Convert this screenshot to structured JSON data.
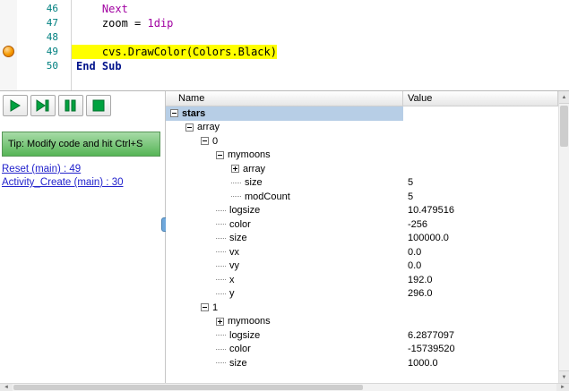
{
  "colors": {
    "execution_highlight": "#ffff00",
    "breakpoint_orange": "#e87c00",
    "line_number_teal": "#008080",
    "keyword_purple": "#a100a1",
    "keyword_navy": "#00128b",
    "debug_icon_green": "#00a23f",
    "tip_banner_green": "#56b556",
    "selection_blue": "#b7cee6",
    "link_blue": "#2222cc"
  },
  "editor": {
    "lines": [
      {
        "num": "46",
        "breakpoint": false,
        "highlight": false,
        "tokens": [
          {
            "t": "    ",
            "c": "plain"
          },
          {
            "t": "Next",
            "c": "purple"
          }
        ]
      },
      {
        "num": "47",
        "breakpoint": false,
        "highlight": false,
        "tokens": [
          {
            "t": "    ",
            "c": "plain"
          },
          {
            "t": "zoom",
            "c": "plain"
          },
          {
            "t": " = ",
            "c": "plain"
          },
          {
            "t": "1dip",
            "c": "purple"
          }
        ]
      },
      {
        "num": "48",
        "breakpoint": false,
        "highlight": false,
        "tokens": []
      },
      {
        "num": "49",
        "breakpoint": true,
        "highlight": true,
        "tokens": [
          {
            "t": "    ",
            "c": "plain"
          },
          {
            "t": "cvs.DrawColor(Colors.Black)",
            "c": "plain"
          }
        ]
      },
      {
        "num": "50",
        "breakpoint": false,
        "highlight": false,
        "tokens": [
          {
            "t": "End Sub",
            "c": "navy"
          }
        ]
      }
    ]
  },
  "toolbar": {
    "buttons": [
      {
        "name": "resume-button",
        "icon": "play"
      },
      {
        "name": "step-button",
        "icon": "step"
      },
      {
        "name": "pause-button",
        "icon": "pause"
      },
      {
        "name": "stop-button",
        "icon": "stop"
      }
    ]
  },
  "tip": {
    "text": "Tip: Modify code and hit Ctrl+S"
  },
  "links": [
    {
      "label": "Reset (main) : 49"
    },
    {
      "label": "Activity_Create (main) : 30"
    }
  ],
  "tree": {
    "columns": [
      "Name",
      "Value"
    ],
    "rows": [
      {
        "level": 0,
        "toggle": "minus",
        "label": "stars",
        "value": "",
        "selected": true
      },
      {
        "level": 1,
        "toggle": "minus",
        "label": "array",
        "value": "",
        "selected": false
      },
      {
        "level": 2,
        "toggle": "minus",
        "label": "0",
        "value": "",
        "selected": false
      },
      {
        "level": 3,
        "toggle": "minus",
        "label": "mymoons",
        "value": "",
        "selected": false
      },
      {
        "level": 4,
        "toggle": "plus",
        "label": "array",
        "value": "",
        "selected": false
      },
      {
        "level": 4,
        "toggle": null,
        "label": "size",
        "value": "5",
        "selected": false
      },
      {
        "level": 4,
        "toggle": null,
        "label": "modCount",
        "value": "5",
        "selected": false
      },
      {
        "level": 3,
        "toggle": null,
        "label": "logsize",
        "value": "10.479516",
        "selected": false
      },
      {
        "level": 3,
        "toggle": null,
        "label": "color",
        "value": "-256",
        "selected": false
      },
      {
        "level": 3,
        "toggle": null,
        "label": "size",
        "value": "100000.0",
        "selected": false
      },
      {
        "level": 3,
        "toggle": null,
        "label": "vx",
        "value": "0.0",
        "selected": false
      },
      {
        "level": 3,
        "toggle": null,
        "label": "vy",
        "value": "0.0",
        "selected": false
      },
      {
        "level": 3,
        "toggle": null,
        "label": "x",
        "value": "192.0",
        "selected": false
      },
      {
        "level": 3,
        "toggle": null,
        "label": "y",
        "value": "296.0",
        "selected": false
      },
      {
        "level": 2,
        "toggle": "minus",
        "label": "1",
        "value": "",
        "selected": false
      },
      {
        "level": 3,
        "toggle": "plus",
        "label": "mymoons",
        "value": "",
        "selected": false
      },
      {
        "level": 3,
        "toggle": null,
        "label": "logsize",
        "value": "6.2877097",
        "selected": false
      },
      {
        "level": 3,
        "toggle": null,
        "label": "color",
        "value": "-15739520",
        "selected": false
      },
      {
        "level": 3,
        "toggle": null,
        "label": "size",
        "value": "1000.0",
        "selected": false
      }
    ]
  },
  "scrollbars": {
    "up_arrow": "▲",
    "down_arrow": "▼",
    "left_arrow": "◄",
    "right_arrow": "►"
  }
}
